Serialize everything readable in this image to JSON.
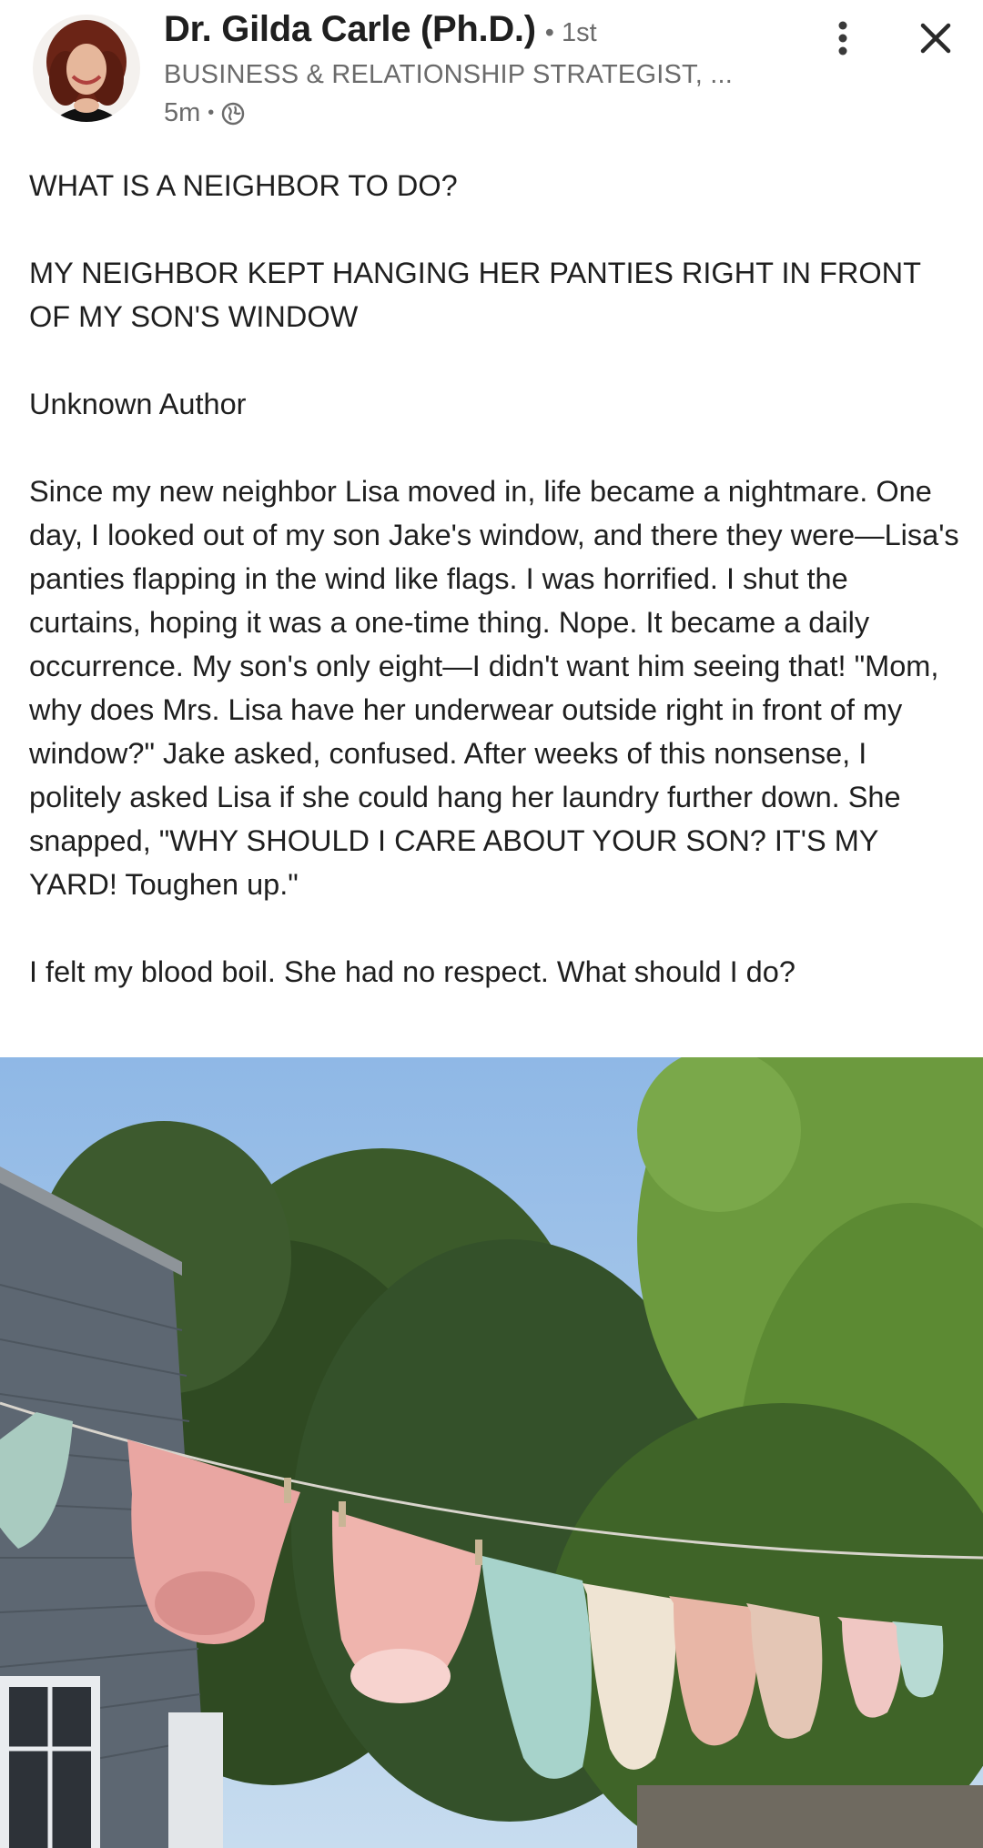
{
  "author": {
    "name": "Dr. Gilda Carle (Ph.D.)",
    "degree": "• 1st",
    "headline": "BUSINESS & RELATIONSHIP STRATEGIST, ...",
    "time": "5m",
    "separator": "•",
    "visibility_icon": "globe-icon"
  },
  "actions": {
    "more_icon": "more-vertical-icon",
    "close_icon": "close-icon"
  },
  "post": {
    "paragraphs": [
      "WHAT IS A NEIGHBOR TO DO?",
      "MY NEIGHBOR KEPT HANGING HER PANTIES RIGHT IN FRONT OF MY SON'S WINDOW",
      "Unknown Author",
      "Since my new neighbor Lisa moved in, life became a nightmare. One day, I looked out of my son Jake's window, and there they were—Lisa's panties flapping in the wind like flags. I was horrified. I shut the curtains, hoping it was a one-time thing. Nope. It became a daily occurrence. My son's only eight—I didn't want him seeing that! \"Mom, why does Mrs. Lisa have her underwear outside right in front of my window?\" Jake asked, confused. After weeks of this nonsense, I politely asked Lisa if she could hang her laundry further down. She snapped, \"WHY SHOULD I CARE ABOUT YOUR SON? IT'S MY YARD! Toughen up.\"",
      "I felt my blood boil. She had no respect. What should I do?"
    ]
  },
  "colors": {
    "text": "#1f1f1f",
    "secondary": "#6b6b6b",
    "sky": "#9fc4ea"
  }
}
